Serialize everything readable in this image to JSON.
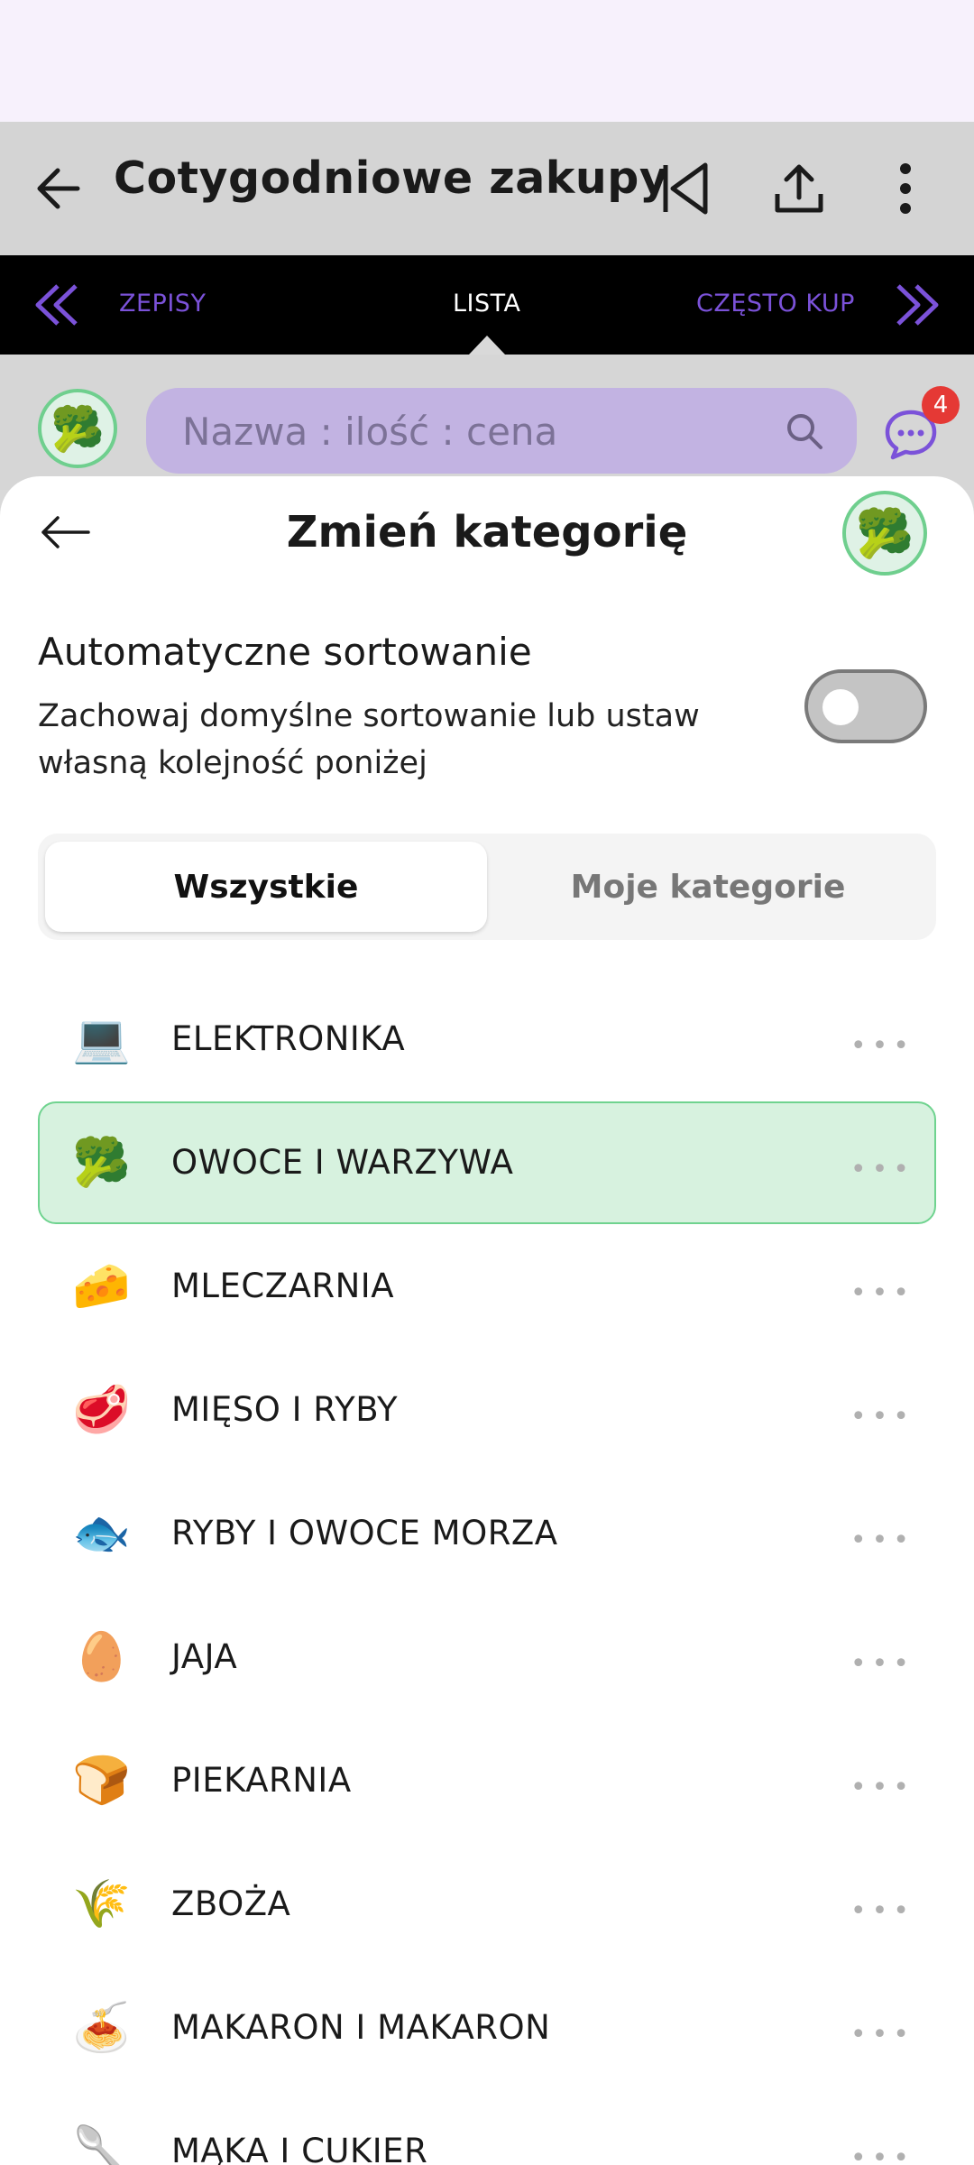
{
  "app_bar": {
    "title": "Cotygodniowe zakupy",
    "icons": [
      "back-arrow-icon",
      "skip-previous-icon",
      "share-icon",
      "more-vert-icon"
    ]
  },
  "tabs": {
    "left": "PRZEPISY",
    "left_visible": "ZEPISY",
    "center": "LISTA",
    "right": "CZĘSTO KUP"
  },
  "search": {
    "placeholder": "Nazwa : ilość : cena",
    "avatar_emoji": "🥦"
  },
  "chat": {
    "badge": "4"
  },
  "sheet": {
    "title": "Zmień kategorię",
    "avatar_emoji": "🥦",
    "auto_sort": {
      "title": "Automatyczne sortowanie",
      "description": "Zachowaj domyślne sortowanie lub ustaw własną kolejność poniżej",
      "enabled": false
    },
    "segments": {
      "all": "Wszystkie",
      "mine": "Moje kategorie",
      "active": "all"
    },
    "categories": [
      {
        "emoji": "💻",
        "label": "ELEKTRONIKA",
        "selected": false
      },
      {
        "emoji": "🥦",
        "label": "OWOCE I WARZYWA",
        "selected": true
      },
      {
        "emoji": "🧀",
        "label": "MLECZARNIA",
        "selected": false
      },
      {
        "emoji": "🥩",
        "label": "MIĘSO I RYBY",
        "selected": false
      },
      {
        "emoji": "🐟",
        "label": "RYBY I OWOCE MORZA",
        "selected": false
      },
      {
        "emoji": "🥚",
        "label": "JAJA",
        "selected": false
      },
      {
        "emoji": "🍞",
        "label": "PIEKARNIA",
        "selected": false
      },
      {
        "emoji": "🌾",
        "label": "ZBOŻA",
        "selected": false
      },
      {
        "emoji": "🍝",
        "label": "MAKARON I MAKARON",
        "selected": false
      },
      {
        "emoji": "🥄",
        "label": "MĄKA I CUKIER",
        "selected": false
      }
    ],
    "more_glyph": "•••"
  },
  "colors": {
    "accent": "#7b52d9",
    "selected_bg": "#d7f2df",
    "selected_border": "#6fd38f",
    "badge": "#e53935"
  }
}
